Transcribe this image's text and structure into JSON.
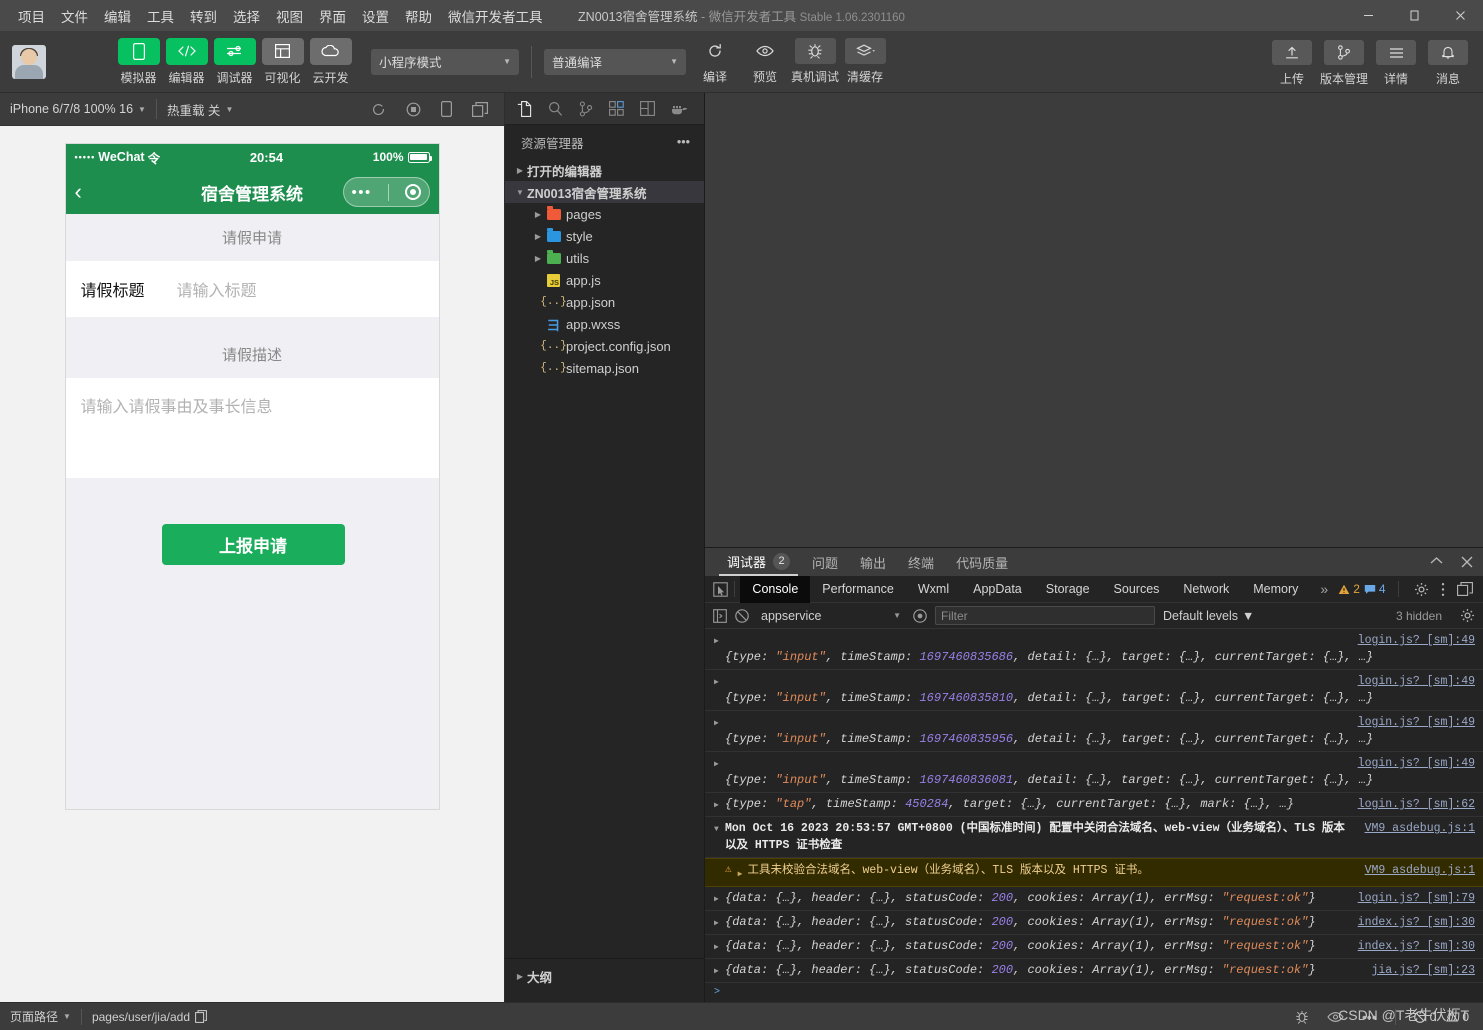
{
  "window": {
    "title_main": "ZN0013宿舍管理系统",
    "title_sep": "-",
    "title_app": "微信开发者工具",
    "title_version": "Stable 1.06.2301160",
    "minimize": "−",
    "maximize": "□",
    "close": "✕"
  },
  "menubar": {
    "items": [
      "项目",
      "文件",
      "编辑",
      "工具",
      "转到",
      "选择",
      "视图",
      "界面",
      "设置",
      "帮助",
      "微信开发者工具"
    ]
  },
  "toolbar": {
    "panels": [
      {
        "label": "模拟器",
        "icon": "phone-icon",
        "state": "green"
      },
      {
        "label": "编辑器",
        "icon": "code-icon",
        "state": "green"
      },
      {
        "label": "调试器",
        "icon": "debug-sliders-icon",
        "state": "green"
      },
      {
        "label": "可视化",
        "icon": "layout-icon",
        "state": "grey"
      },
      {
        "label": "云开发",
        "icon": "cloud-icon",
        "state": "grey"
      }
    ],
    "mode_select": "小程序模式",
    "compile_select": "普通编译",
    "actions": [
      {
        "label": "编译",
        "icon": "refresh-icon"
      },
      {
        "label": "预览",
        "icon": "eye-icon"
      },
      {
        "label": "真机调试",
        "icon": "bug-icon"
      },
      {
        "label": "清缓存",
        "icon": "layers-icon"
      }
    ],
    "right_actions": [
      {
        "label": "上传",
        "icon": "upload-icon"
      },
      {
        "label": "版本管理",
        "icon": "branch-icon"
      },
      {
        "label": "详情",
        "icon": "menu-icon"
      },
      {
        "label": "消息",
        "icon": "bell-icon"
      }
    ]
  },
  "simulator": {
    "device": "iPhone 6/7/8 100% 16",
    "hotreload": "热重载 关",
    "icons": [
      "refresh-icon",
      "record-icon",
      "rotate-icon",
      "window-icon"
    ],
    "phone": {
      "carrier": "WeChat",
      "signal_dots": "•••••",
      "wifi": "令",
      "time": "20:54",
      "battery_percent": "100%",
      "nav_back": "‹",
      "nav_title": "宿舍管理系统",
      "capsule_dots": "•••",
      "section_title_1": "请假申请",
      "field_label": "请假标题",
      "field_placeholder": "请输入标题",
      "section_title_2": "请假描述",
      "textarea_placeholder": "请输入请假事由及事长信息",
      "submit_label": "上报申请"
    }
  },
  "explorer": {
    "activity_icons": [
      "files-icon",
      "search-icon",
      "source-control-icon",
      "extensions-icon",
      "layout-icon",
      "docker-icon"
    ],
    "title": "资源管理器",
    "more": "•••",
    "sections": [
      {
        "label": "打开的编辑器",
        "expanded": false
      },
      {
        "label": "ZN0013宿舍管理系统",
        "expanded": true
      }
    ],
    "files": [
      {
        "name": "pages",
        "type": "folder",
        "color": "red",
        "indent": 1,
        "expandable": true
      },
      {
        "name": "style",
        "type": "folder",
        "color": "blue",
        "indent": 1,
        "expandable": true
      },
      {
        "name": "utils",
        "type": "folder",
        "color": "green",
        "indent": 1,
        "expandable": true
      },
      {
        "name": "app.js",
        "type": "js",
        "indent": 1,
        "expandable": false
      },
      {
        "name": "app.json",
        "type": "json",
        "indent": 1,
        "expandable": false
      },
      {
        "name": "app.wxss",
        "type": "wxss",
        "indent": 1,
        "expandable": false
      },
      {
        "name": "project.config.json",
        "type": "json",
        "indent": 1,
        "expandable": false
      },
      {
        "name": "sitemap.json",
        "type": "json",
        "indent": 1,
        "expandable": false
      }
    ],
    "outline": "大纲"
  },
  "devtools": {
    "tabs": [
      {
        "label": "调试器",
        "badge": "2",
        "active": true
      },
      {
        "label": "问题",
        "badge": "",
        "active": false
      },
      {
        "label": "输出",
        "badge": "",
        "active": false
      },
      {
        "label": "终端",
        "badge": "",
        "active": false
      },
      {
        "label": "代码质量",
        "badge": "",
        "active": false
      }
    ],
    "collapse_icon": "chevron-up-icon",
    "close_icon": "close-icon",
    "panes": [
      "Console",
      "Performance",
      "Wxml",
      "AppData",
      "Storage",
      "Sources",
      "Network",
      "Memory"
    ],
    "active_pane": "Console",
    "overflow": "»",
    "warning_count": "2",
    "info_count": "4",
    "console_filter": {
      "context": "appservice",
      "filter_placeholder": "Filter",
      "levels": "Default levels",
      "hidden": "3 hidden"
    },
    "logs": [
      {
        "kind": "object",
        "prefix": "{type: ",
        "str1": "\"input\"",
        "mid": ", timeStamp: ",
        "num": "1697460835686",
        "suffix": ", detail: {…}, target: {…}, currentTarget: {…}, …}",
        "source": "login.js? [sm]:49",
        "source_above": true
      },
      {
        "kind": "object",
        "prefix": "{type: ",
        "str1": "\"input\"",
        "mid": ", timeStamp: ",
        "num": "1697460835810",
        "suffix": ", detail: {…}, target: {…}, currentTarget: {…}, …}",
        "source": "login.js? [sm]:49",
        "source_above": true
      },
      {
        "kind": "object",
        "prefix": "{type: ",
        "str1": "\"input\"",
        "mid": ", timeStamp: ",
        "num": "1697460835956",
        "suffix": ", detail: {…}, target: {…}, currentTarget: {…}, …}",
        "source": "login.js? [sm]:49",
        "source_above": true
      },
      {
        "kind": "object",
        "prefix": "{type: ",
        "str1": "\"input\"",
        "mid": ", timeStamp: ",
        "num": "1697460836081",
        "suffix": ", detail: {…}, target: {…}, currentTarget: {…}, …}",
        "source": "login.js? [sm]:49",
        "source_above": true
      },
      {
        "kind": "object",
        "prefix": "{type: ",
        "str1": "\"tap\"",
        "mid": ", timeStamp: ",
        "num": "450284",
        "suffix": ", target: {…}, currentTarget: {…}, mark: {…}, …}",
        "source": "login.js? [sm]:62",
        "source_above": false
      },
      {
        "kind": "timestamp",
        "text": "Mon Oct 16 2023 20:53:57 GMT+0800 (中国标准时间) 配置中关闭合法域名、web-view（业务域名）、TLS 版本以及 HTTPS 证书检查",
        "source": "VM9 asdebug.js:1"
      },
      {
        "kind": "warning",
        "text": "工具未校验合法域名、web-view（业务域名）、TLS 版本以及 HTTPS 证书。",
        "source": "VM9 asdebug.js:1"
      },
      {
        "kind": "response",
        "prefix": "{data: {…}, header: {…}, statusCode: ",
        "num": "200",
        "mid": ", cookies: Array(1), errMsg: ",
        "str1": "\"request:ok\"",
        "suffix": "}",
        "source": "login.js? [sm]:79"
      },
      {
        "kind": "response",
        "prefix": "{data: {…}, header: {…}, statusCode: ",
        "num": "200",
        "mid": ", cookies: Array(1), errMsg: ",
        "str1": "\"request:ok\"",
        "suffix": "}",
        "source": "index.js? [sm]:30"
      },
      {
        "kind": "response",
        "prefix": "{data: {…}, header: {…}, statusCode: ",
        "num": "200",
        "mid": ", cookies: Array(1), errMsg: ",
        "str1": "\"request:ok\"",
        "suffix": "}",
        "source": "index.js? [sm]:30"
      },
      {
        "kind": "response",
        "prefix": "{data: {…}, header: {…}, statusCode: ",
        "num": "200",
        "mid": ", cookies: Array(1), errMsg: ",
        "str1": "\"request:ok\"",
        "suffix": "}",
        "source": "jia.js? [sm]:23"
      }
    ],
    "prompt": ">"
  },
  "statusbar": {
    "page_path_label": "页面路径",
    "page_path_value": "pages/user/jia/add",
    "errors": "0",
    "warnings": "0",
    "watermark": "CSDN @T老牛伏枥T"
  },
  "colors": {
    "accent_green": "#07c160",
    "wechat_nav": "#1e8e4e",
    "submit_green": "#1aad5c",
    "warning": "#e3a33c",
    "info": "#6aa9e8"
  }
}
